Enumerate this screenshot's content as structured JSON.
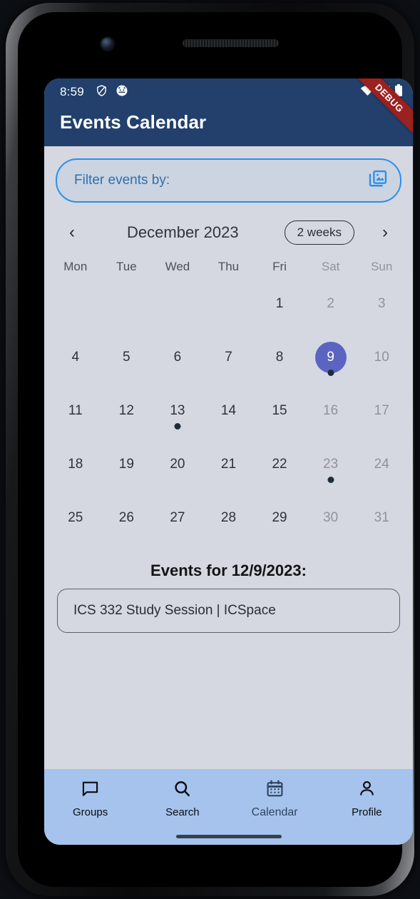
{
  "status_bar": {
    "time": "8:59",
    "left_icons": [
      "shield-icon",
      "cat-face-icon"
    ],
    "right_icons": [
      "wifi-icon",
      "cellular-signal-icon",
      "battery-icon"
    ]
  },
  "app_bar": {
    "title": "Events Calendar",
    "background_color": "#22406b",
    "debug_ribbon_label": "DEBUG",
    "debug_ribbon_color": "#9b2020"
  },
  "filter": {
    "label": "Filter events by:",
    "icon": "photo-library-icon",
    "accent_color": "#2b90ed"
  },
  "calendar": {
    "prev_label": "‹",
    "next_label": "›",
    "month_label": "December 2023",
    "format_button_label": "2 weeks",
    "weekdays": [
      {
        "label": "Mon",
        "weekend": false
      },
      {
        "label": "Tue",
        "weekend": false
      },
      {
        "label": "Wed",
        "weekend": false
      },
      {
        "label": "Thu",
        "weekend": false
      },
      {
        "label": "Fri",
        "weekend": false
      },
      {
        "label": "Sat",
        "weekend": true
      },
      {
        "label": "Sun",
        "weekend": true
      }
    ],
    "selected_day": 9,
    "selected_color": "#5c64c2",
    "event_dot_color": "#1e2d3c",
    "days": [
      {
        "label": "",
        "empty": true
      },
      {
        "label": "",
        "empty": true
      },
      {
        "label": "",
        "empty": true
      },
      {
        "label": "",
        "empty": true
      },
      {
        "label": "1",
        "weekend": false,
        "dot": false
      },
      {
        "label": "2",
        "weekend": true,
        "dot": false
      },
      {
        "label": "3",
        "weekend": true,
        "dot": false
      },
      {
        "label": "4",
        "weekend": false,
        "dot": false
      },
      {
        "label": "5",
        "weekend": false,
        "dot": false
      },
      {
        "label": "6",
        "weekend": false,
        "dot": false
      },
      {
        "label": "7",
        "weekend": false,
        "dot": false
      },
      {
        "label": "8",
        "weekend": false,
        "dot": false
      },
      {
        "label": "9",
        "weekend": true,
        "dot": true,
        "selected": true
      },
      {
        "label": "10",
        "weekend": true,
        "dot": false
      },
      {
        "label": "11",
        "weekend": false,
        "dot": false
      },
      {
        "label": "12",
        "weekend": false,
        "dot": false
      },
      {
        "label": "13",
        "weekend": false,
        "dot": true
      },
      {
        "label": "14",
        "weekend": false,
        "dot": false
      },
      {
        "label": "15",
        "weekend": false,
        "dot": false
      },
      {
        "label": "16",
        "weekend": true,
        "dot": false
      },
      {
        "label": "17",
        "weekend": true,
        "dot": false
      },
      {
        "label": "18",
        "weekend": false,
        "dot": false
      },
      {
        "label": "19",
        "weekend": false,
        "dot": false
      },
      {
        "label": "20",
        "weekend": false,
        "dot": false
      },
      {
        "label": "21",
        "weekend": false,
        "dot": false
      },
      {
        "label": "22",
        "weekend": false,
        "dot": false
      },
      {
        "label": "23",
        "weekend": true,
        "dot": true
      },
      {
        "label": "24",
        "weekend": true,
        "dot": false
      },
      {
        "label": "25",
        "weekend": false,
        "dot": false
      },
      {
        "label": "26",
        "weekend": false,
        "dot": false
      },
      {
        "label": "27",
        "weekend": false,
        "dot": false
      },
      {
        "label": "28",
        "weekend": false,
        "dot": false
      },
      {
        "label": "29",
        "weekend": false,
        "dot": false
      },
      {
        "label": "30",
        "weekend": true,
        "dot": false
      },
      {
        "label": "31",
        "weekend": true,
        "dot": false
      }
    ]
  },
  "events": {
    "title": "Events for 12/9/2023:",
    "items": [
      {
        "text": "ICS 332 Study Session | ICSpace"
      }
    ]
  },
  "bottom_nav": {
    "background_color": "#a5c3ec",
    "items": [
      {
        "label": "Groups",
        "icon": "chat-bubble-icon",
        "active": false
      },
      {
        "label": "Search",
        "icon": "search-icon",
        "active": false
      },
      {
        "label": "Calendar",
        "icon": "calendar-icon",
        "active": true
      },
      {
        "label": "Profile",
        "icon": "person-icon",
        "active": false
      }
    ]
  }
}
